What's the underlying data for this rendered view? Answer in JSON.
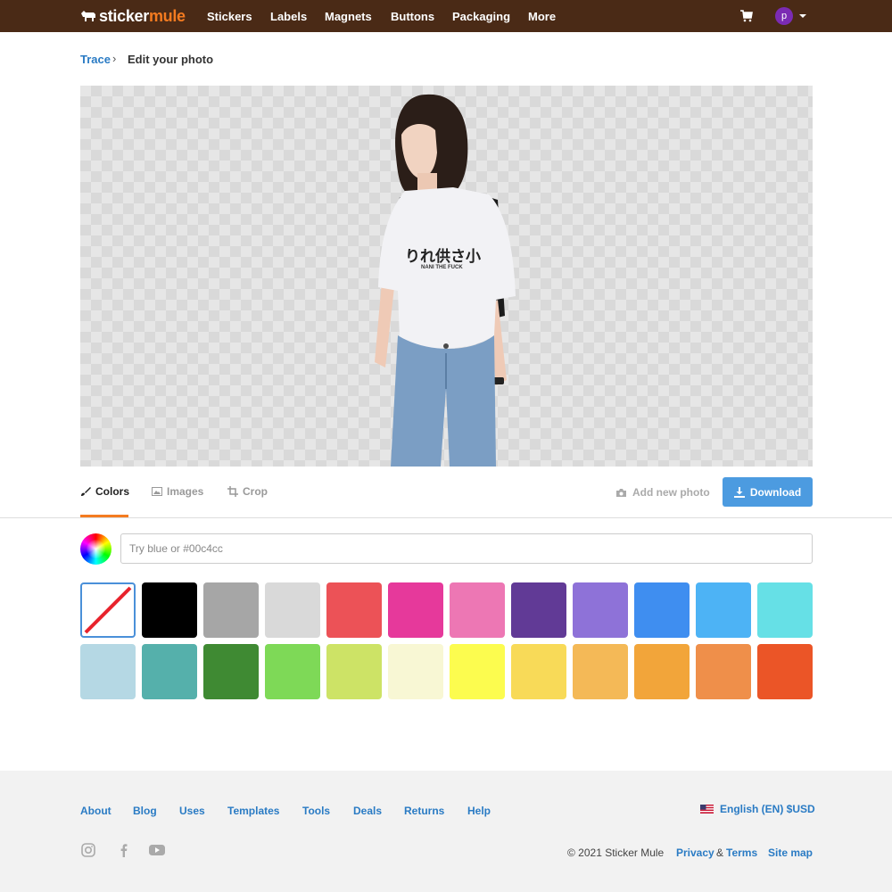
{
  "brand": {
    "word1": "sticker",
    "word2": "mule"
  },
  "nav": {
    "items": [
      "Stickers",
      "Labels",
      "Magnets",
      "Buttons",
      "Packaging",
      "More"
    ],
    "avatar_initial": "p"
  },
  "breadcrumb": {
    "link": "Trace",
    "current": "Edit your photo"
  },
  "tabs": {
    "colors": "Colors",
    "images": "Images",
    "crop": "Crop"
  },
  "actions": {
    "add_photo": "Add new photo",
    "download": "Download"
  },
  "color_input": {
    "placeholder": "Try blue or #00c4cc"
  },
  "swatches": [
    "none",
    "#000000",
    "#a6a6a6",
    "#d9d9d9",
    "#ec5257",
    "#e6399b",
    "#ed77b4",
    "#613a96",
    "#8e72d8",
    "#3f8ef0",
    "#4db3f5",
    "#66e0e6",
    "#b5d8e4",
    "#55b0ab",
    "#3f8a33",
    "#7ed957",
    "#cde366",
    "#f8f7d4",
    "#fcfc4f",
    "#f8da58",
    "#f4b957",
    "#f2a53a",
    "#ef8f4a",
    "#eb5527"
  ],
  "footer": {
    "links": [
      "About",
      "Blog",
      "Uses",
      "Templates",
      "Tools",
      "Deals",
      "Returns",
      "Help"
    ],
    "language": "English (EN) $USD",
    "copyright": "© 2021 Sticker Mule",
    "privacy": "Privacy",
    "amp": "&",
    "terms": "Terms",
    "sitemap": "Site map"
  },
  "shirt_text": {
    "line1": "りれ供さ小",
    "line2": "NANI THE FUCK"
  },
  "colors": {
    "topbar": "#4a2a16",
    "accent": "#f47b20",
    "link": "#2a7bc4",
    "button": "#4c9be0"
  }
}
